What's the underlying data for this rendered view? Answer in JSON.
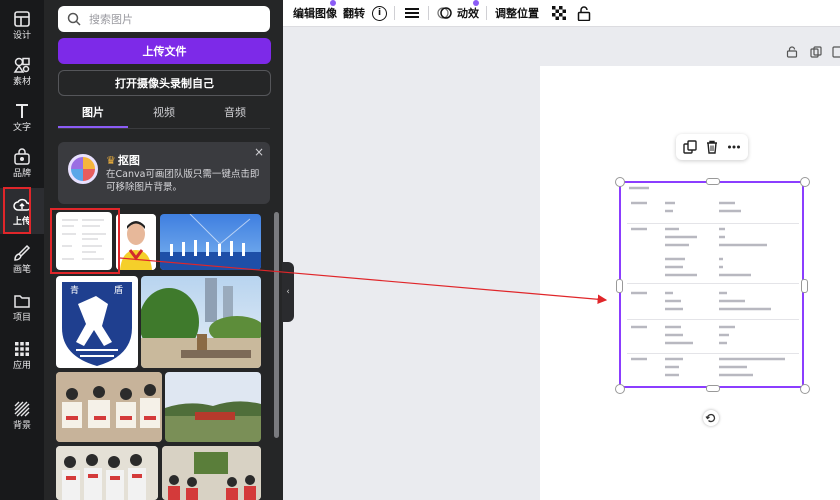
{
  "rail": {
    "items": [
      {
        "label": "设计",
        "icon": "layout-icon"
      },
      {
        "label": "素材",
        "icon": "elements-icon"
      },
      {
        "label": "文字",
        "icon": "text-icon"
      },
      {
        "label": "品牌",
        "icon": "brand-icon"
      },
      {
        "label": "上传",
        "icon": "upload-cloud-icon"
      },
      {
        "label": "画笔",
        "icon": "brush-icon"
      },
      {
        "label": "项目",
        "icon": "folder-icon"
      },
      {
        "label": "应用",
        "icon": "apps-grid-icon"
      },
      {
        "label": "背景",
        "icon": "background-pattern-icon"
      }
    ]
  },
  "panel": {
    "search_placeholder": "搜索图片",
    "upload_button": "上传文件",
    "camera_button": "打开摄像头录制自己",
    "tabs": [
      "图片",
      "视频",
      "音频"
    ],
    "promo": {
      "title": "抠图",
      "text": "在Canva可画团队版只需一键点击即可移除图片背景。",
      "close": "×"
    }
  },
  "toolbar": {
    "edit_image": "编辑图像",
    "flip": "翻转",
    "info": "i",
    "animate": "动效",
    "position": "调整位置"
  },
  "colors": {
    "accent": "#7d2ae8",
    "selection": "#8b3dff",
    "annotation": "#e0262a"
  }
}
